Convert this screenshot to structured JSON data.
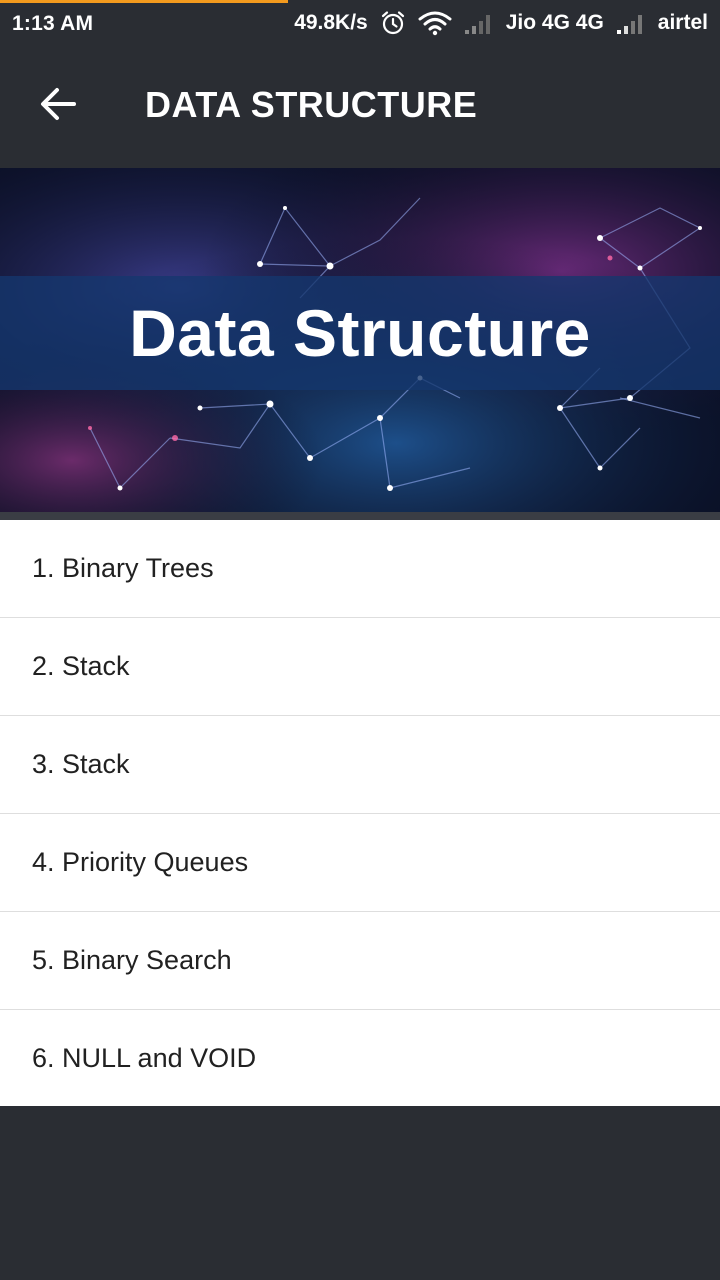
{
  "status_bar": {
    "time": "1:13 AM",
    "net_speed": "49.8K/s",
    "carrier1": "Jio 4G 4G",
    "carrier2": "airtel",
    "load_progress": 0.4
  },
  "app_bar": {
    "title": "DATA STRUCTURE"
  },
  "banner": {
    "text": "Data Structure"
  },
  "topics": [
    {
      "label": "1. Binary Trees"
    },
    {
      "label": "2. Stack"
    },
    {
      "label": "3. Stack"
    },
    {
      "label": "4. Priority Queues"
    },
    {
      "label": "5. Binary Search"
    },
    {
      "label": "6. NULL and VOID"
    }
  ],
  "colors": {
    "app_bar": "#2a2d33",
    "progress": "#f39a1e",
    "list_bg": "#ffffff",
    "list_text": "#212121"
  }
}
